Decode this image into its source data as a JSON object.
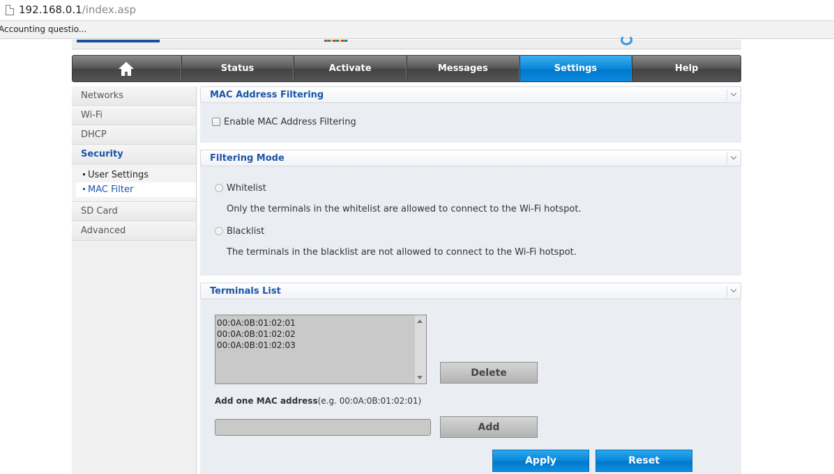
{
  "browser": {
    "url_host": "192.168.0.1",
    "url_path": "/index.asp",
    "bookmark": "Accounting questio..."
  },
  "nav": {
    "tabs": [
      {
        "label": "Status"
      },
      {
        "label": "Activate"
      },
      {
        "label": "Messages"
      },
      {
        "label": "Settings",
        "active": true
      },
      {
        "label": "Help"
      }
    ]
  },
  "sidebar": {
    "items": [
      {
        "label": "Networks"
      },
      {
        "label": "Wi-Fi"
      },
      {
        "label": "DHCP"
      },
      {
        "label": "Security",
        "active": true
      },
      {
        "label": "SD Card"
      },
      {
        "label": "Advanced"
      }
    ],
    "subitems": [
      {
        "label": "User Settings"
      },
      {
        "label": "MAC Filter",
        "active": true
      }
    ]
  },
  "mac_filtering": {
    "title": "MAC Address Filtering",
    "enable_label": "Enable MAC Address Filtering",
    "enabled": false
  },
  "filtering_mode": {
    "title": "Filtering Mode",
    "whitelist_label": "Whitelist",
    "whitelist_desc": "Only the terminals in the whitelist are allowed to connect to the Wi-Fi hotspot.",
    "blacklist_label": "Blacklist",
    "blacklist_desc": "The terminals in the blacklist are not allowed to connect to the Wi-Fi hotspot."
  },
  "terminals": {
    "title": "Terminals List",
    "entries": [
      "00:0A:0B:01:02:01",
      "00:0A:0B:01:02:02",
      "00:0A:0B:01:02:03"
    ],
    "delete_label": "Delete",
    "add_label_bold": "Add one MAC address",
    "add_label_hint": "(e.g. 00:0A:0B:01:02:01)",
    "add_input_value": "",
    "add_button": "Add"
  },
  "actions": {
    "apply": "Apply",
    "reset": "Reset"
  },
  "colors": {
    "accent_blue": "#0a86d8",
    "title_blue": "#1a55a8"
  }
}
